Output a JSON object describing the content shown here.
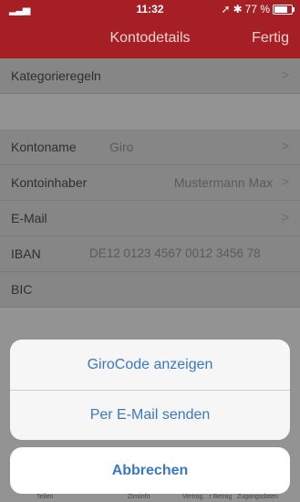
{
  "status": {
    "time": "11:32",
    "battery": "77 %"
  },
  "nav": {
    "title": "Kontodetails",
    "done_label": "Fertig"
  },
  "rows": {
    "kategorieregeln": {
      "label": "Kategorieregeln"
    },
    "kontoname": {
      "label": "Kontoname",
      "value": "Giro"
    },
    "kontoinhaber": {
      "label": "Kontoinhaber",
      "value": "Mustermann Max"
    },
    "email": {
      "label": "E-Mail"
    },
    "iban": {
      "label": "IBAN",
      "value": "DE12 0123 4567 0012 3456 78"
    },
    "bic": {
      "label": "BIC"
    }
  },
  "action_sheet": {
    "girocode_label": "GiroCode anzeigen",
    "email_label": "Per E-Mail senden",
    "cancel_label": "Abbrechen"
  },
  "tabbar": [
    "Teilen",
    "Zinsinfo",
    "Vertrag…r Betrag",
    "Zugangsdaten"
  ],
  "colors": {
    "header": "#a61f24",
    "accent": "#3a78c5"
  }
}
